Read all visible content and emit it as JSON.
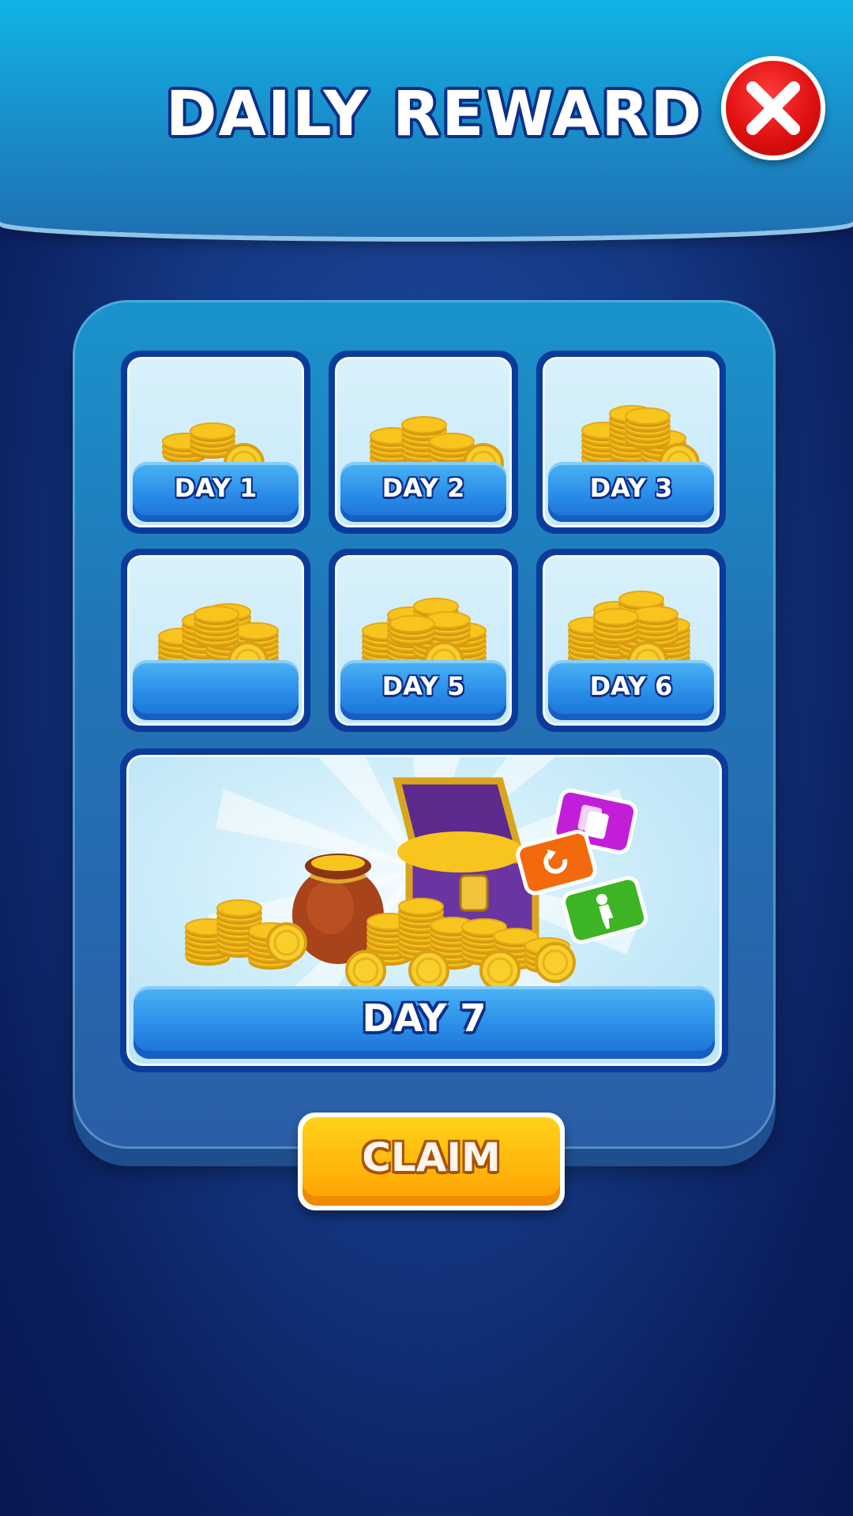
{
  "header": {
    "title": "DAILY REWARD"
  },
  "icons": {
    "close": "close-icon",
    "coin": "coin-stack-icon",
    "chest": "treasure-chest-icon",
    "bag": "coin-bag-icon",
    "powerups": [
      "cards-icon",
      "undo-icon",
      "hint-figure-icon"
    ]
  },
  "rewards": [
    {
      "label": "DAY 1",
      "coins": 1
    },
    {
      "label": "DAY 2",
      "coins": 2
    },
    {
      "label": "DAY 3",
      "coins": 3
    },
    {
      "label": "",
      "coins": 4
    },
    {
      "label": "DAY 5",
      "coins": 5
    },
    {
      "label": "DAY 6",
      "coins": 6
    }
  ],
  "grand_reward": {
    "label": "DAY 7"
  },
  "actions": {
    "claim_label": "CLAIM"
  },
  "colors": {
    "accent": "#1a6fd2",
    "claim": "#ffb80c",
    "close": "#e01010",
    "coin": "#f7c51e"
  }
}
